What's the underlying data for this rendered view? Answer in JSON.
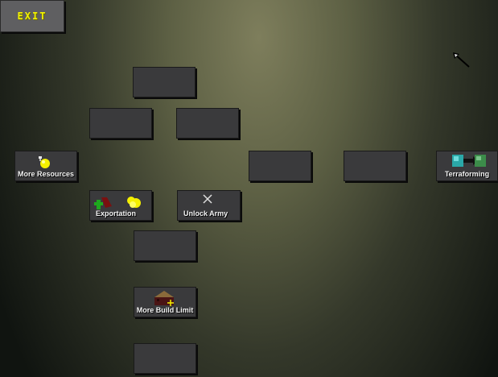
{
  "exit_button": {
    "label": "EXIT"
  },
  "upgrades": {
    "more_resources": {
      "label": "More Resources",
      "icon": "resource-orb-icon"
    },
    "exportation": {
      "label": "Exportation",
      "icon": "export-goods-icon"
    },
    "unlock_army": {
      "label": "Unlock Army",
      "icon": "crossed-swords-icon"
    },
    "more_build_limit": {
      "label": "More Build Limit",
      "icon": "building-plus-icon"
    },
    "terraforming": {
      "label": "Terraforming",
      "icon": "terrain-transform-icon"
    }
  },
  "colors": {
    "exit_text": "#f2f200",
    "tile": "#3a3a3c",
    "resource_yellow": "#f5f000"
  }
}
